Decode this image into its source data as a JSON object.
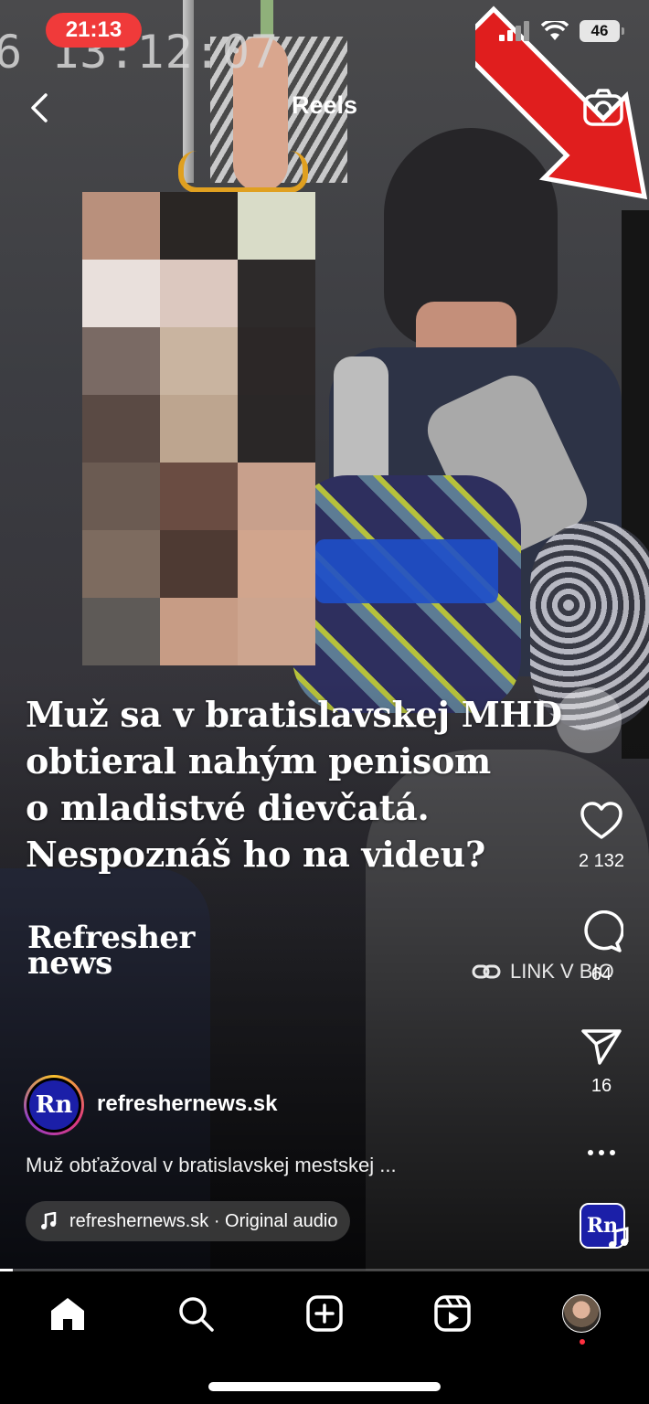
{
  "status_bar": {
    "time": "21:13",
    "battery": "46"
  },
  "header": {
    "title": "Reels",
    "back_icon": "chevron-left-icon",
    "camera_icon": "camera-icon"
  },
  "video": {
    "timestamp_overlay": "6 13:12:07",
    "headline": [
      "Muž sa v bratislavskej MHD",
      "obtieral nahým penisom",
      "o mladistvé dievčatá.",
      "Nespoznáš ho na videu?"
    ],
    "brand": [
      "Refresher",
      "news"
    ],
    "link_label": "LINK V BIO"
  },
  "actions": {
    "likes": "2 132",
    "comments": "64",
    "shares": "16",
    "audio_thumb": "Rn"
  },
  "post": {
    "avatar_initials": "Rn",
    "username": "refreshernews.sk",
    "caption": "Muž obťažoval v bratislavskej mestskej ...",
    "audio": "refreshernews.sk · Original audio"
  },
  "playback_progress": 0.02,
  "tabs": [
    "home",
    "search",
    "create",
    "reels",
    "profile"
  ],
  "colors": {
    "time_pill": "#f03a3a",
    "brand_blue": "#1b1fa8",
    "notification_dot": "#ff3040"
  }
}
